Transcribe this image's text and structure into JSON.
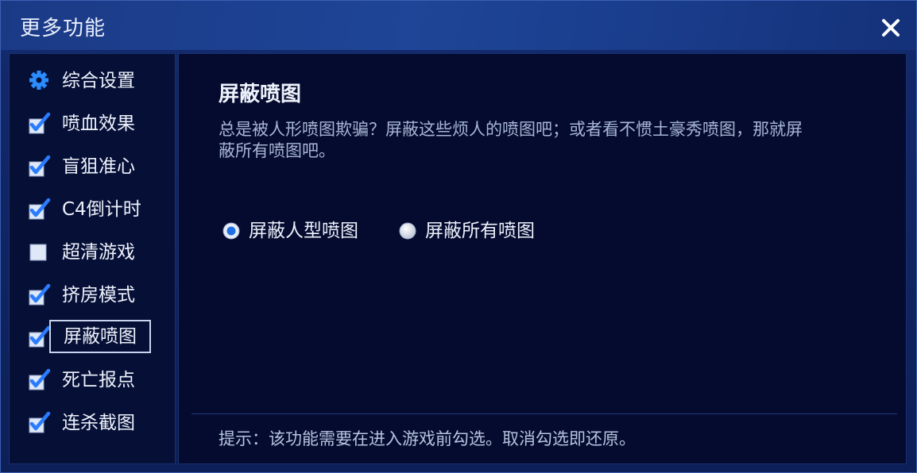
{
  "window": {
    "title": "更多功能",
    "close_icon": "close-icon"
  },
  "sidebar": {
    "items": [
      {
        "label": "综合设置",
        "icon": "gear-icon",
        "state": "settings"
      },
      {
        "label": "喷血效果",
        "icon": "checkbox",
        "state": "checked"
      },
      {
        "label": "盲狙准心",
        "icon": "checkbox",
        "state": "checked"
      },
      {
        "label": "C4倒计时",
        "icon": "checkbox",
        "state": "checked"
      },
      {
        "label": "超清游戏",
        "icon": "checkbox",
        "state": "unchecked"
      },
      {
        "label": "挤房模式",
        "icon": "checkbox",
        "state": "checked"
      },
      {
        "label": "屏蔽喷图",
        "icon": "checkbox",
        "state": "checked",
        "active": true
      },
      {
        "label": "死亡报点",
        "icon": "checkbox",
        "state": "checked"
      },
      {
        "label": "连杀截图",
        "icon": "checkbox",
        "state": "checked"
      }
    ]
  },
  "main": {
    "title": "屏蔽喷图",
    "description": "总是被人形喷图欺骗？屏蔽这些烦人的喷图吧；或者看不惯土豪秀喷图，那就屏蔽所有喷图吧。",
    "options": [
      {
        "label": "屏蔽人型喷图",
        "selected": true
      },
      {
        "label": "屏蔽所有喷图",
        "selected": false
      }
    ],
    "tip": "提示：该功能需要在进入游戏前勾选。取消勾选即还原。"
  },
  "colors": {
    "accent_blue": "#2a7cff",
    "checkbox_bg": "#dfe8f8",
    "text": "#eef2fb",
    "panel_bg": "#040b2f"
  }
}
